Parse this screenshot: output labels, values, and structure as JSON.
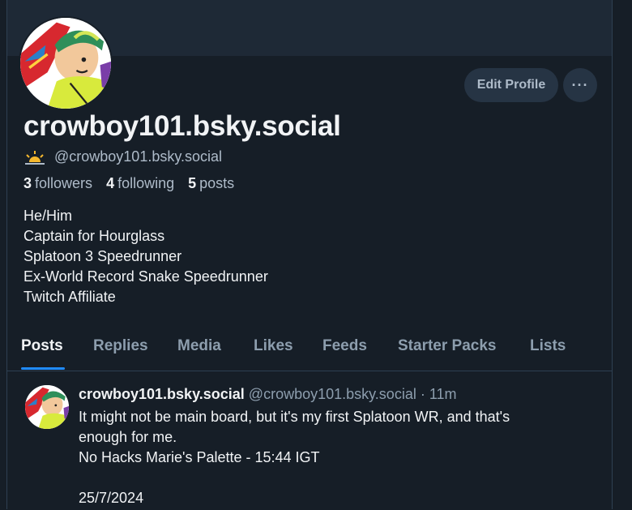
{
  "profile": {
    "display_name": "crowboy101.bsky.social",
    "handle": "@crowboy101.bsky.social",
    "handle_icon": "sunrise-icon",
    "stats": {
      "followers_count": "3",
      "followers_label": "followers",
      "following_count": "4",
      "following_label": "following",
      "posts_count": "5",
      "posts_label": "posts"
    },
    "bio": [
      "He/Him",
      "Captain for Hourglass",
      "Splatoon 3 Speedrunner",
      "Ex-World Record Snake Speedrunner",
      "Twitch Affiliate"
    ]
  },
  "actions": {
    "edit_profile": "Edit Profile",
    "more": "···"
  },
  "tabs": [
    "Posts",
    "Replies",
    "Media",
    "Likes",
    "Feeds",
    "Starter Packs",
    "Lists"
  ],
  "active_tab": "Posts",
  "post": {
    "author_name": "crowboy101.bsky.social",
    "author_handle_time": "@crowboy101.bsky.social · 11m",
    "lines": [
      "It might not be main board, but it's my first Splatoon WR, and that's",
      "enough for me.",
      "No Hacks Marie's Palette - 15:44 IGT",
      "",
      "25/7/2024"
    ]
  },
  "colors": {
    "background": "#161e27",
    "banner": "#1e2936",
    "accent": "#208bfe",
    "muted_text": "#8d9eae"
  }
}
